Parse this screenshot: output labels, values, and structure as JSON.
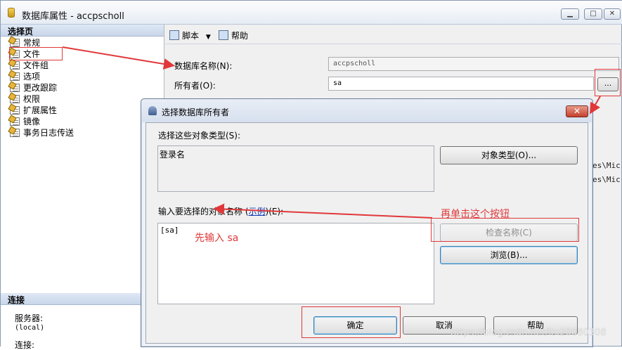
{
  "window": {
    "title": "数据库属性 - accpscholl",
    "minimize": "▭",
    "maximize": "□",
    "close": "X"
  },
  "left_pane": {
    "header": "选择页",
    "items": [
      {
        "label": "常规"
      },
      {
        "label": "文件"
      },
      {
        "label": "文件组"
      },
      {
        "label": "选项"
      },
      {
        "label": "更改跟踪"
      },
      {
        "label": "权限"
      },
      {
        "label": "扩展属性"
      },
      {
        "label": "镜像"
      },
      {
        "label": "事务日志传送"
      }
    ],
    "connection_header": "连接",
    "server_label": "服务器:",
    "server_value": "(local)",
    "connection_label": "连接:"
  },
  "toolbar": {
    "script_label": "脚本",
    "help_label": "帮助"
  },
  "general": {
    "db_name_label": "数据库名称(N):",
    "db_name_value": "accpscholl",
    "owner_label": "所有者(O):",
    "owner_value": "sa",
    "browse_label": "...",
    "path_fragment_1": "es\\Mic:",
    "path_fragment_2": "es\\Mic:"
  },
  "dialog": {
    "title": "选择数据库所有者",
    "close_label": "X",
    "object_types_label": "选择这些对象类型(S):",
    "object_types_value": "登录名",
    "object_types_button": "对象类型(O)...",
    "enter_names_label_pre": "输入要选择的对象名称 (",
    "enter_names_link": "示例",
    "enter_names_label_post": ")(E):",
    "names_value": "[sa]",
    "check_names_button": "检查名称(C)",
    "browse_button": "浏览(B)...",
    "ok_button": "确定",
    "cancel_button": "取消",
    "help_button": "帮助"
  },
  "annotations": {
    "enter_sa": "先输入 sa",
    "click_button": "再单击这个按钮"
  },
  "watermark": "https://blog.csdn.net/ltx20080308",
  "colors": {
    "annotation_red": "#e0383a",
    "link_blue": "#0b36b8",
    "header_bg": "#c8d6ea"
  }
}
